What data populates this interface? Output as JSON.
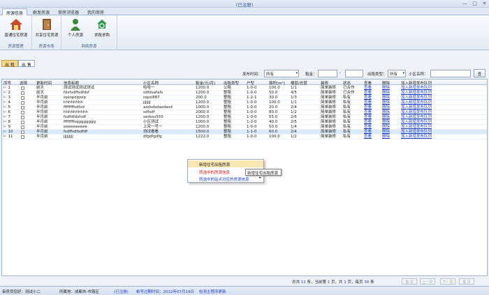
{
  "window": {
    "title": "(已注册)",
    "min": "—",
    "max": "□",
    "close": "✕"
  },
  "ribbon_tabs": [
    "房源信息",
    "群发房源",
    "审房浏览器",
    "我的审房"
  ],
  "ribbon": {
    "groups": [
      {
        "label": "房源管理",
        "buttons": [
          {
            "label": "普通住宅房源",
            "icon": "house-icon"
          }
        ]
      },
      {
        "label": "房源市场",
        "buttons": [
          {
            "label": "共享住宅房源",
            "icon": "door-icon"
          }
        ]
      },
      {
        "label": "网络房源",
        "buttons": [
          {
            "label": "个人房源",
            "icon": "person-icon"
          },
          {
            "label": "求租求购",
            "icon": "recycle-house-icon"
          }
        ]
      }
    ]
  },
  "doc_tabs": [
    "出 租",
    "出 售"
  ],
  "filters": {
    "publish_time_label": "发布时间：",
    "publish_time_value": "所有",
    "rent_label": "租金：",
    "rent_min": "",
    "rent_sep": "-",
    "rent_max": "",
    "rent_type_label": "出租类型：",
    "rent_type_value": "所有",
    "community_label": "小区名称：",
    "community_value": "",
    "search_label": "查"
  },
  "table": {
    "headers": [
      "序号",
      "选择",
      "更新时间",
      "信息标题",
      "小区名称",
      "租金(元/月)",
      "出租类型",
      "户型",
      "面积(m²)",
      "楼层/总层",
      "装修",
      "状态",
      "查看",
      "删除",
      "加入新增发布队列"
    ],
    "rows": [
      [
        "1",
        "前天",
        "测试测试测试测试",
        "哈哈一",
        "1200.0",
        "公租",
        "1-0-0",
        "100.0",
        "1/1",
        "简单装修",
        "已合作",
        "查看",
        "删除",
        "加入新增发布队列"
      ],
      [
        "2",
        "前天",
        "fdsfsdffsdfdsf",
        "sdfdsafafs",
        "1200.0",
        "整租",
        "1-0-0",
        "50.0",
        "4/5",
        "简单装修",
        "已合作",
        "查看",
        "删除",
        "加入新增发布队列"
      ],
      [
        "3",
        "半月前",
        "opiopoipoip",
        "iopoi887",
        "200.0",
        "整租",
        "1-2-1",
        "30.0",
        "1/3",
        "简单装修",
        "私有",
        "查看",
        "删除",
        "加入新增发布队列"
      ],
      [
        "4",
        "半月前",
        "hhhhhhhh",
        "jjjjjjj",
        "1200.0",
        "整租",
        "1-0-0",
        "100.0",
        "1/1",
        "简单装修",
        "私有",
        "查看",
        "删除",
        "加入新增发布队列"
      ],
      [
        "5",
        "半月前",
        "ffffffffsdfsd",
        "asdsdsdasdasd",
        "1000.0",
        "整租",
        "1-0-0",
        "20.0",
        "2/4",
        "简单装修",
        "私有",
        "查看",
        "删除",
        "加入新增发布队列"
      ],
      [
        "6",
        "半月前",
        "hhhhhhhhhh",
        "sdfsdf",
        "2000.0",
        "整租",
        "1-0-0",
        "80.0",
        "1/2",
        "简单装修",
        "私有",
        "查看",
        "删除",
        "加入新增发布队列"
      ],
      [
        "7",
        "半月前",
        "fsdfdfdsfsdf",
        "sedsss555",
        "1200.0",
        "整租",
        "1-0-0",
        "55.0",
        "2/6",
        "简单装修",
        "私有",
        "查看",
        "删除",
        "加入新增发布队列"
      ],
      [
        "8",
        "半月前",
        "ffffffffsqggggggg",
        "小区测试",
        "1000.0",
        "整租",
        "1-2-0",
        "40.0",
        "2/5",
        "简单装修",
        "私有",
        "查看",
        "删除",
        "加入新增发布队列"
      ],
      [
        "9",
        "半月前",
        "eeeeeeeeee",
        "上宋一号一",
        "1200.0",
        "整租",
        "1-0-0",
        "50.0",
        "1/4",
        "简单装修",
        "私有",
        "查看",
        "删除",
        "加入新增发布队列"
      ],
      [
        "10",
        "半月前",
        "fsdffsdfsdfdf",
        "测试看看",
        "1500.0",
        "整租",
        "1-1-0",
        "60.0",
        "2/4",
        "简单装修",
        "私有",
        "查看",
        "删除",
        "加入新增发布队列"
      ],
      [
        "11",
        "半月前",
        "jjjjjjjjj",
        "dfgdfgdfg",
        "1222.0",
        "整租",
        "1-0-0",
        "100.0",
        "1/2",
        "简单装修",
        "私有",
        "查看",
        "删除",
        "加入新增发布队列"
      ]
    ]
  },
  "context_menu": {
    "items": [
      "新增住宅出租房源",
      "转选中的房源信息",
      "转选中的站点对应的房源信息"
    ],
    "tooltip": "新增住宅出租房源"
  },
  "pager": {
    "t1": "总共",
    "total": "11",
    "t2": "条，当前第",
    "current": "1",
    "t3": "页，共",
    "pages": "1",
    "t4": "页，每页",
    "per_page": "30",
    "t5": "条",
    "first": "首 页",
    "prev": "上一页",
    "next": "下一页",
    "last": "尾 页"
  },
  "status": {
    "user": "审房员您好：测试小二",
    "area": "所属地：成都市-市辖区",
    "reg": "(已注册)",
    "expire": "帐号过期时间：2012年07月19日",
    "update": "检测主程序更新"
  }
}
